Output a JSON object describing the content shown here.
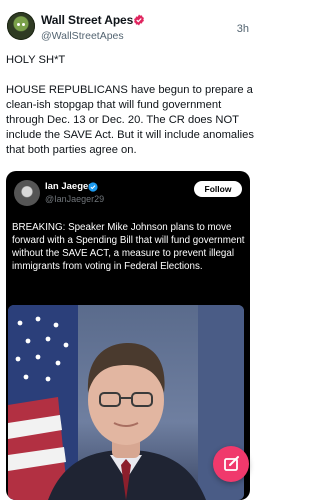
{
  "tweet": {
    "author_name": "Wall Street Apes",
    "author_handle": "@WallStreetApes",
    "time": "3h",
    "paragraphs": [
      "HOLY SH*T",
      "HOUSE REPUBLICANS have begun to prepare a clean-ish stopgap that will fund government through Dec. 13 or Dec. 20. The CR does NOT include the SAVE Act. But it will include anomalies that both parties agree on."
    ]
  },
  "quoted": {
    "author_name": "Ian Jaeger",
    "author_handle": "@IanJaeger29",
    "follow_label": "Follow",
    "text": "BREAKING: Speaker Mike Johnson plans to move forward with a Spending Bill that will fund government without the SAVE ACT, a measure to prevent illegal immigrants from voting in Federal Elections."
  },
  "colors": {
    "verified": "#e0245e",
    "quoted_verified": "#1d9bf0",
    "compose_fab": "#f0396c"
  },
  "icons": {
    "verified": "verified-badge-icon",
    "compose": "compose-icon"
  }
}
